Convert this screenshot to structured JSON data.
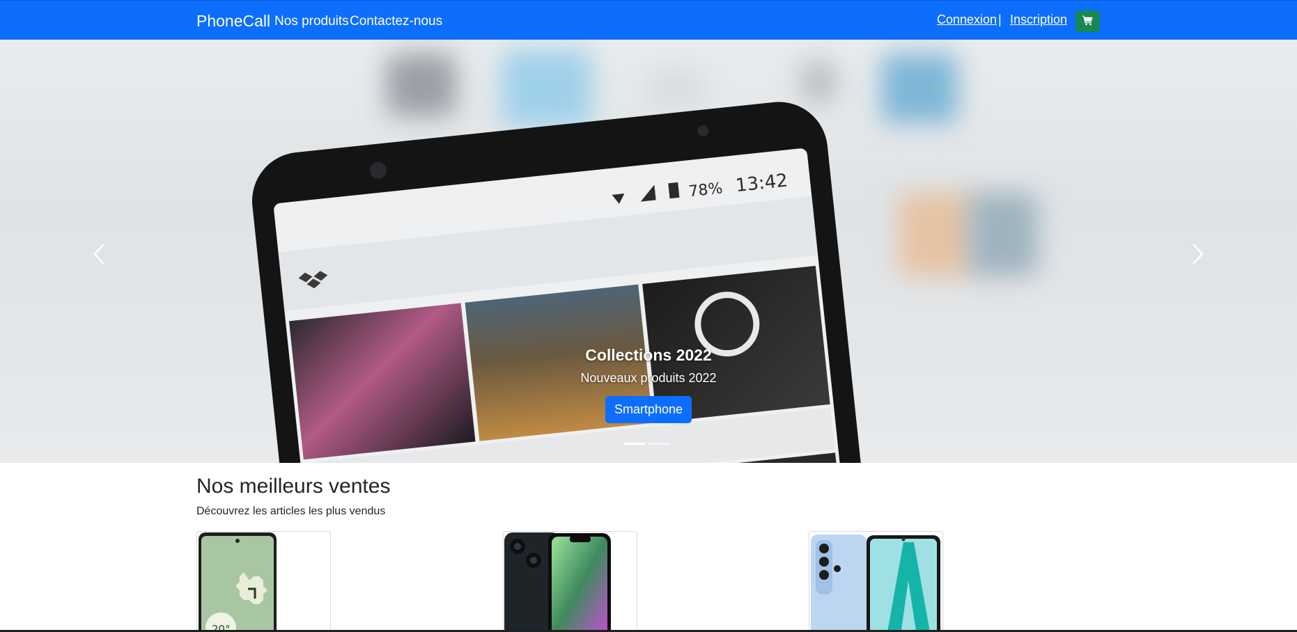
{
  "navbar": {
    "brand": "PhoneCall",
    "links": [
      "Nos produits",
      "Contactez-nous"
    ],
    "login": "Connexion",
    "separator": "|",
    "signup": "Inscription",
    "cart_icon": "cart-icon"
  },
  "hero": {
    "phone_status": {
      "battery": "78%",
      "time": "13:42"
    },
    "caption": {
      "title": "Collections 2022",
      "subtitle": "Nouveaux produits 2022",
      "button": "Smartphone"
    },
    "indicator_count": 2,
    "active_indicator": 0
  },
  "best_sellers": {
    "title": "Nos meilleurs ventes",
    "subtitle": "Découvrez les articles les plus vendus",
    "products": [
      {
        "screen_temp": "20°"
      },
      {},
      {}
    ]
  },
  "colors": {
    "primary": "#0d6efd",
    "success": "#198754"
  }
}
